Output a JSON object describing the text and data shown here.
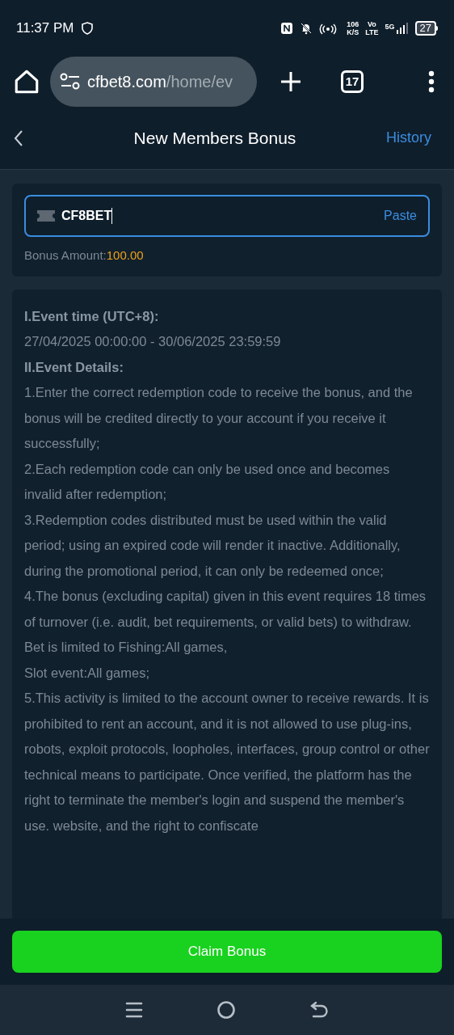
{
  "status_bar": {
    "time": "11:37 PM",
    "speed_value": "106",
    "speed_unit": "K/S",
    "volte_top": "Vo",
    "volte_bottom": "LTE",
    "network": "5G",
    "battery": "27"
  },
  "browser": {
    "url_host": "cfbet8.com",
    "url_path": "/home/ev",
    "tab_count": "17"
  },
  "header": {
    "title": "New Members Bonus",
    "action": "History"
  },
  "code_card": {
    "value": "CF8BET",
    "paste": "Paste",
    "amount_label": "Bonus Amount:",
    "amount_value": "100.00"
  },
  "rules": [
    {
      "kind": "heading",
      "text": "I.Event time (UTC+8):"
    },
    {
      "kind": "text",
      "text": "27/04/2025 00:00:00 - 30/06/2025 23:59:59"
    },
    {
      "kind": "heading",
      "text": "II.Event Details:"
    },
    {
      "kind": "text",
      "text": "1.Enter the correct redemption code to receive the bonus, and the bonus will be credited directly to your account if you receive it successfully;"
    },
    {
      "kind": "text",
      "text": "2.Each redemption code can only be used once and becomes invalid after redemption;"
    },
    {
      "kind": "text",
      "text": "3.Redemption codes distributed must be used within the valid period; using an expired code will render it inactive. Additionally, during the promotional period, it can only be redeemed once;"
    },
    {
      "kind": "text",
      "text": "4.The bonus (excluding capital) given in this event requires 18 times of turnover (i.e. audit, bet requirements, or valid bets) to withdraw. Bet is limited to Fishing:All games,"
    },
    {
      "kind": "text",
      "text": "Slot event:All games;"
    },
    {
      "kind": "text",
      "text": "5.This activity is limited to the account owner to receive rewards. It is prohibited to rent an account, and it is not allowed to use plug-ins, robots, exploit protocols, loopholes, interfaces, group control or other technical means to participate. Once verified, the platform has the right to terminate the member's login and suspend the member's use. website, and the right to confiscate"
    }
  ],
  "claim_button": "Claim Bonus"
}
